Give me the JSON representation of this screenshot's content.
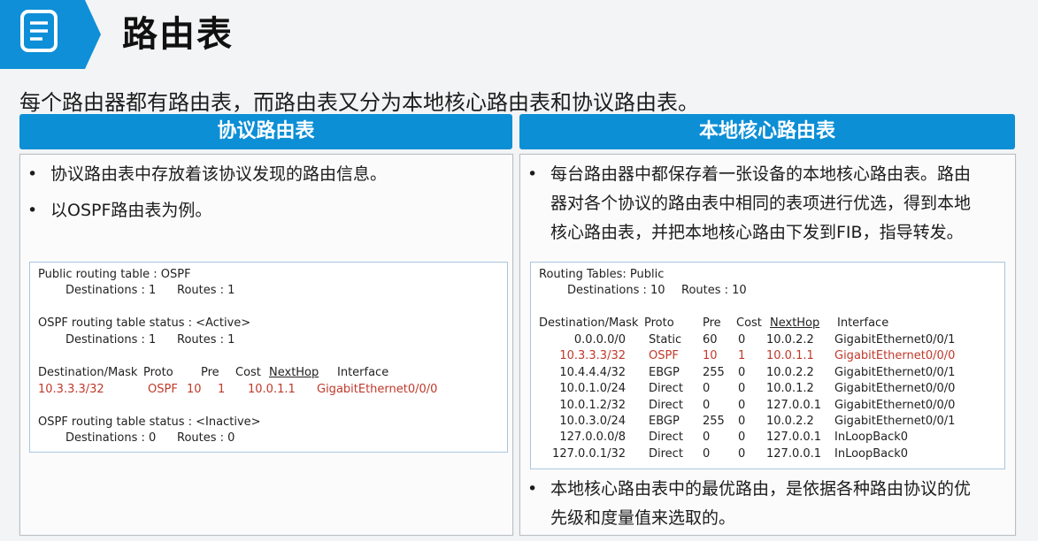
{
  "header": {
    "title": "路由表",
    "icon": "document-list-icon"
  },
  "intro": "每个路由器都有路由表，而路由表又分为本地核心路由表和协议路由表。",
  "colors": {
    "accent": "#0d8fd6",
    "highlight": "#c0392b"
  },
  "left": {
    "heading": "协议路由表",
    "bullets": [
      "协议路由表中存放着该协议发现的路由信息。",
      "以OSPF路由表为例。"
    ],
    "code": {
      "line1": "Public routing table : OSPF",
      "dest1": "Destinations : 1",
      "routes1": "Routes : 1",
      "line2": "OSPF routing table status : <Active>",
      "dest2": "Destinations : 1",
      "routes2": "Routes : 1",
      "hdr": {
        "dest": "Destination/Mask",
        "proto": "Proto",
        "pre": "Pre",
        "cost": "Cost",
        "nexthop": "NextHop",
        "iface": "Interface"
      },
      "row": {
        "dest": "10.3.3.3/32",
        "proto": "OSPF",
        "pre": "10",
        "cost": "1",
        "nexthop": "10.0.1.1",
        "iface": "GigabitEthernet0/0/0"
      },
      "line3": "OSPF routing table status : <Inactive>",
      "dest3": "Destinations : 0",
      "routes3": "Routes : 0"
    }
  },
  "right": {
    "heading": "本地核心路由表",
    "bullet1": [
      "每台路由器中都保存着一张设备的本地核心路由表。路由",
      "器对各个协议的路由表中相同的表项进行优选，得到本地",
      "核心路由表，并把本地核心路由下发到FIB，指导转发。"
    ],
    "bullet2": [
      "本地核心路由表中的最优路由，是依据各种路由协议的优",
      "先级和度量值来选取的。"
    ],
    "code": {
      "title": "Routing Tables: Public",
      "dest": "Destinations : 10",
      "routes": "Routes : 10",
      "hdr": {
        "dest": "Destination/Mask",
        "proto": "Proto",
        "pre": "Pre",
        "cost": "Cost",
        "nexthop": "NextHop",
        "iface": "Interface"
      },
      "rows": [
        {
          "dest": "0.0.0.0/0",
          "proto": "Static",
          "pre": "60",
          "cost": "0",
          "nexthop": "10.0.2.2",
          "iface": "GigabitEthernet0/0/1"
        },
        {
          "dest": "10.3.3.3/32",
          "proto": "OSPF",
          "pre": "10",
          "cost": "1",
          "nexthop": "10.0.1.1",
          "iface": "GigabitEthernet0/0/0"
        },
        {
          "dest": "10.4.4.4/32",
          "proto": "EBGP",
          "pre": "255",
          "cost": "0",
          "nexthop": "10.0.2.2",
          "iface": "GigabitEthernet0/0/1"
        },
        {
          "dest": "10.0.1.0/24",
          "proto": "Direct",
          "pre": "0",
          "cost": "0",
          "nexthop": "10.0.1.2",
          "iface": "GigabitEthernet0/0/0"
        },
        {
          "dest": "10.0.1.2/32",
          "proto": "Direct",
          "pre": "0",
          "cost": "0",
          "nexthop": "127.0.0.1",
          "iface": "GigabitEthernet0/0/0"
        },
        {
          "dest": "10.0.3.0/24",
          "proto": "EBGP",
          "pre": "255",
          "cost": "0",
          "nexthop": "10.0.2.2",
          "iface": "GigabitEthernet0/0/1"
        },
        {
          "dest": "127.0.0.0/8",
          "proto": "Direct",
          "pre": "0",
          "cost": "0",
          "nexthop": "127.0.0.1",
          "iface": "InLoopBack0"
        },
        {
          "dest": "127.0.0.1/32",
          "proto": "Direct",
          "pre": "0",
          "cost": "0",
          "nexthop": "127.0.0.1",
          "iface": "InLoopBack0"
        }
      ]
    }
  }
}
